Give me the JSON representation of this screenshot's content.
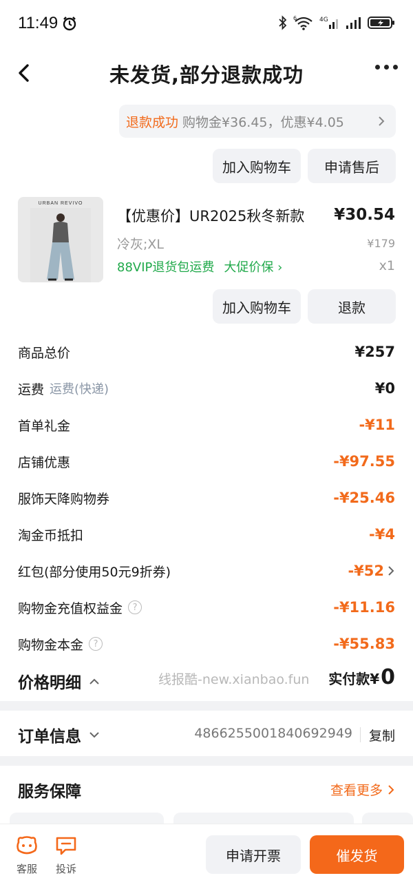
{
  "status_bar": {
    "time": "11:49",
    "network_label": "4G",
    "wifi_label": "6"
  },
  "nav": {
    "title": "未发货,部分退款成功"
  },
  "refund_banner": {
    "status": "退款成功",
    "detail": "购物金¥36.45，优惠¥4.05"
  },
  "order_actions": {
    "add_cart": "加入购物车",
    "after_sale": "申请售后"
  },
  "product": {
    "brand": "URBAN REVIVO",
    "title": "【优惠价】UR2025秋冬新款",
    "price": "¥30.54",
    "sku": "冷灰;XL",
    "original_price": "¥179",
    "tag_vip": "88VIP退货包运费",
    "tag_protect": "大促价保 ›",
    "quantity": "x1",
    "add_cart": "加入购物车",
    "refund": "退款"
  },
  "price_rows": [
    {
      "label": "商品总价",
      "sub": "",
      "value": "¥257",
      "negative": false,
      "help": false,
      "arrow": false
    },
    {
      "label": "运费",
      "sub": "运费(快递)",
      "value": "¥0",
      "negative": false,
      "help": false,
      "arrow": false
    },
    {
      "label": "首单礼金",
      "sub": "",
      "value": "-¥11",
      "negative": true,
      "help": false,
      "arrow": false
    },
    {
      "label": "店铺优惠",
      "sub": "",
      "value": "-¥97.55",
      "negative": true,
      "help": false,
      "arrow": false
    },
    {
      "label": "服饰天降购物券",
      "sub": "",
      "value": "-¥25.46",
      "negative": true,
      "help": false,
      "arrow": false
    },
    {
      "label": "淘金币抵扣",
      "sub": "",
      "value": "-¥4",
      "negative": true,
      "help": false,
      "arrow": false
    },
    {
      "label": "红包(部分使用50元9折券)",
      "sub": "",
      "value": "-¥52",
      "negative": true,
      "help": false,
      "arrow": true
    },
    {
      "label": "购物金充值权益金",
      "sub": "",
      "value": "-¥11.16",
      "negative": true,
      "help": true,
      "arrow": false
    },
    {
      "label": "购物金本金",
      "sub": "",
      "value": "-¥55.83",
      "negative": true,
      "help": true,
      "arrow": false
    }
  ],
  "price_detail": {
    "label": "价格明细",
    "watermark": "线报酷-new.xianbao.fun",
    "paid_label": "实付款¥",
    "paid_value": "0"
  },
  "order_info": {
    "label": "订单信息",
    "number": "4866255001840692949",
    "copy": "复制"
  },
  "service": {
    "label": "服务保障",
    "more": "查看更多"
  },
  "bottom_bar": {
    "service": "客服",
    "complain": "投诉",
    "invoice": "申请开票",
    "urge": "催发货"
  },
  "colors": {
    "accent": "#f26a1b",
    "green": "#20a94a"
  }
}
